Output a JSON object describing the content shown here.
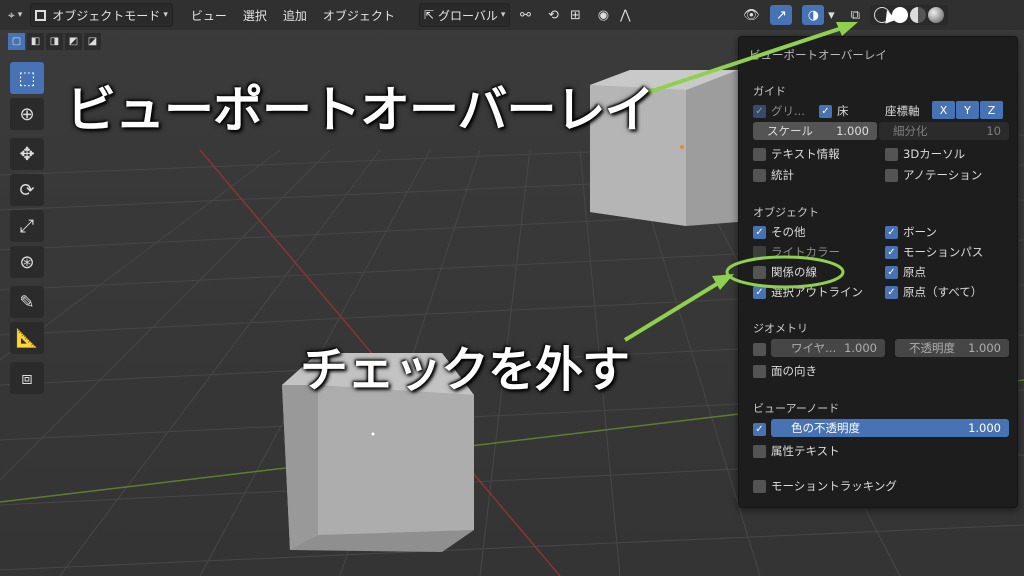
{
  "header": {
    "editor_icon": "viewport-editor-icon",
    "mode_label": "オブジェクトモード",
    "menus": [
      "ビュー",
      "選択",
      "追加",
      "オブジェクト"
    ],
    "orientation_label": "グローバル"
  },
  "toolbar": {
    "tools": [
      "select-box-icon",
      "cursor-icon",
      "move-icon",
      "rotate-icon",
      "scale-icon",
      "transform-icon",
      "annotate-icon",
      "measure-icon",
      "add-cube-icon"
    ]
  },
  "overlay_panel": {
    "title": "ビューポートオーバーレイ",
    "guides": {
      "section": "ガイド",
      "grid_label": "グリ...",
      "floor_label": "床",
      "axes_label": "座標軸",
      "axes": [
        "X",
        "Y",
        "Z"
      ],
      "scale_label": "スケール",
      "scale_value": "1.000",
      "subdivision_label": "細分化",
      "subdivision_value": "10",
      "text_info_label": "テキスト情報",
      "cursor3d_label": "3Dカーソル",
      "stats_label": "統計",
      "annotations_label": "アノテーション"
    },
    "objects": {
      "section": "オブジェクト",
      "extras_label": "その他",
      "bones_label": "ボーン",
      "light_colors_label": "ライトカラー",
      "motion_paths_label": "モーションパス",
      "relationship_lines_label": "関係の線",
      "origins_label": "原点",
      "outline_selected_label": "選択アウトライン",
      "origins_all_label": "原点（すべて）"
    },
    "geometry": {
      "section": "ジオメトリ",
      "wireframe_label": "ワイヤ...",
      "wireframe_value": "1.000",
      "opacity_label": "不透明度",
      "opacity_value": "1.000",
      "face_orientation_label": "面の向き"
    },
    "viewer_node": {
      "section": "ビューアーノード",
      "color_opacity_label": "色の不透明度",
      "color_opacity_value": "1.000",
      "attribute_text_label": "属性テキスト"
    },
    "motion_tracking_label": "モーショントラッキング"
  },
  "annotations": {
    "callout_title": "ビューポートオーバーレイ",
    "callout_instruction": "チェックを外す"
  },
  "colors": {
    "accent": "#4772b3",
    "annotation_arrow": "#8fd14f"
  }
}
